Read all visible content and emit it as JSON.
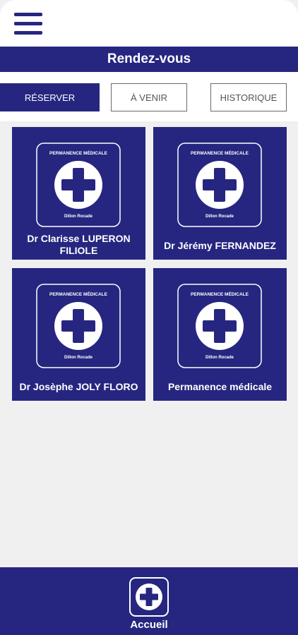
{
  "header": {
    "menu_icon": "hamburger-menu-icon",
    "title": "Rendez-vous"
  },
  "tabs": [
    {
      "label": "RÉSERVER",
      "active": true
    },
    {
      "label": "À VENIR",
      "active": false
    },
    {
      "label": "HISTORIQUE",
      "active": false
    }
  ],
  "logo": {
    "top_text": "PERMANENCE MÉDICALE",
    "bottom_text": "Dillon Rocade",
    "icon": "medical-cross-icon"
  },
  "cards": [
    {
      "name": "Dr Clarisse LUPERON FILIOLE"
    },
    {
      "name": "Dr Jérémy FERNANDEZ"
    },
    {
      "name": "Dr Josèphe JOLY FLORO"
    },
    {
      "name": "Permanence médicale"
    }
  ],
  "footer": {
    "home_label": "Accueil",
    "home_icon": "medical-cross-icon"
  },
  "colors": {
    "primary": "#262680",
    "background": "#f0f0f0",
    "white": "#ffffff"
  }
}
